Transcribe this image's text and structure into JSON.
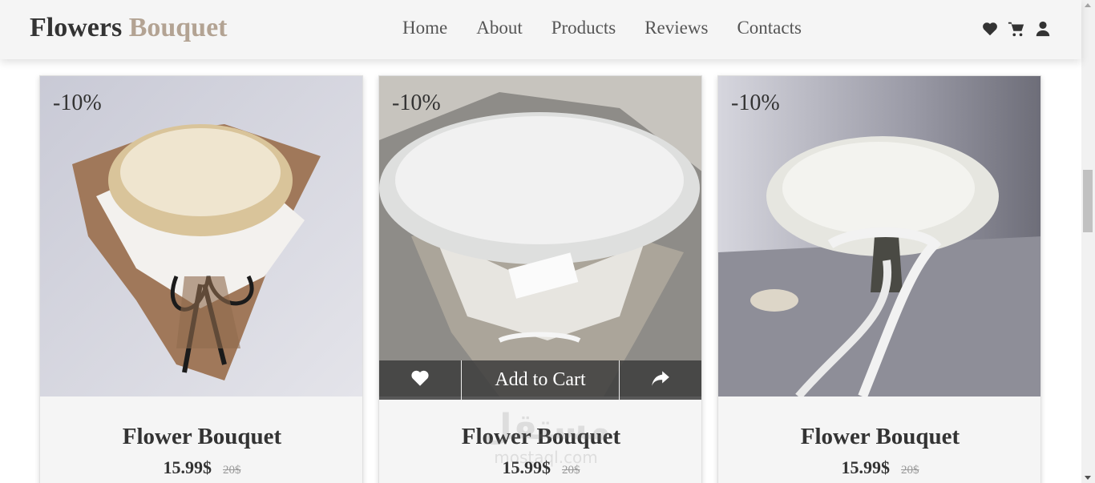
{
  "header": {
    "logo_main": "Flowers",
    "logo_accent": "Bouquet",
    "nav": [
      {
        "label": "Home"
      },
      {
        "label": "About"
      },
      {
        "label": "Products"
      },
      {
        "label": "Reviews"
      },
      {
        "label": "Contacts"
      }
    ],
    "icons": [
      "heart-icon",
      "cart-icon",
      "user-icon"
    ]
  },
  "products": [
    {
      "badge": "-10%",
      "name": "Flower Bouquet",
      "price": "15.99$",
      "old_price": "20$"
    },
    {
      "badge": "-10%",
      "name": "Flower Bouquet",
      "price": "15.99$",
      "old_price": "20$"
    },
    {
      "badge": "-10%",
      "name": "Flower Bouquet",
      "price": "15.99$",
      "old_price": "20$"
    }
  ],
  "hover_actions": {
    "add_to_cart": "Add to Cart",
    "icons": [
      "heart-icon",
      "share-icon"
    ]
  },
  "watermark": {
    "arabic": "مستقل",
    "latin": "mostaql.com"
  },
  "colors": {
    "accent": "#b3a393",
    "header_bg": "#f5f5f5",
    "card_bg": "#f5f5f5",
    "action_bar": "#3c3c3c"
  }
}
